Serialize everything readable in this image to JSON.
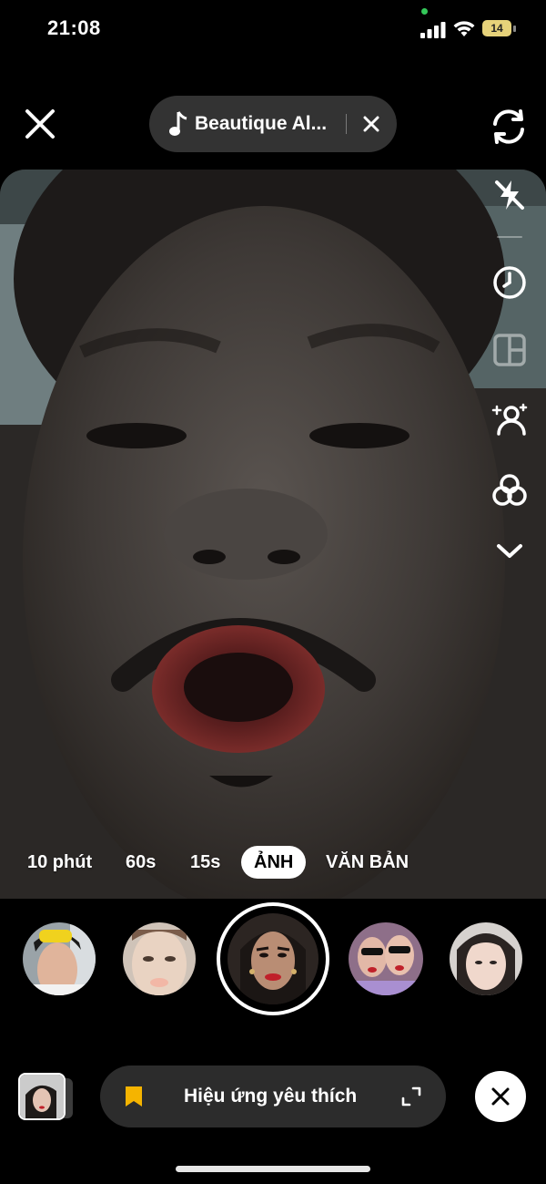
{
  "status_bar": {
    "time": "21:08",
    "battery_level": "14",
    "icons": [
      "signal-icon",
      "wifi-icon",
      "battery-icon"
    ]
  },
  "top_bar": {
    "close_icon": "close-icon",
    "sound_name": "Beautique Al...",
    "sound_icon": "music-note-icon",
    "clear_sound_icon": "close-icon",
    "flip_icon": "flip-camera-icon"
  },
  "right_toolbar": [
    "flash-off-icon",
    "timer-icon",
    "layout-icon",
    "beauty-icon",
    "filters-icon",
    "chevron-down-icon"
  ],
  "modes": {
    "items": [
      "10 phút",
      "60s",
      "15s",
      "ẢNH",
      "VĂN BẢN"
    ],
    "selected": "ẢNH"
  },
  "effects": {
    "selected_index": 2,
    "count": 5
  },
  "bottom_bar": {
    "favorites_label": "Hiệu ứng yêu thích",
    "favorites_icon": "bookmark-icon",
    "expand_icon": "expand-icon",
    "remove_icon": "close-icon"
  },
  "colors": {
    "bookmark": "#f5b400",
    "wifi_dot": "#34c759",
    "battery": "#e6d27a"
  }
}
